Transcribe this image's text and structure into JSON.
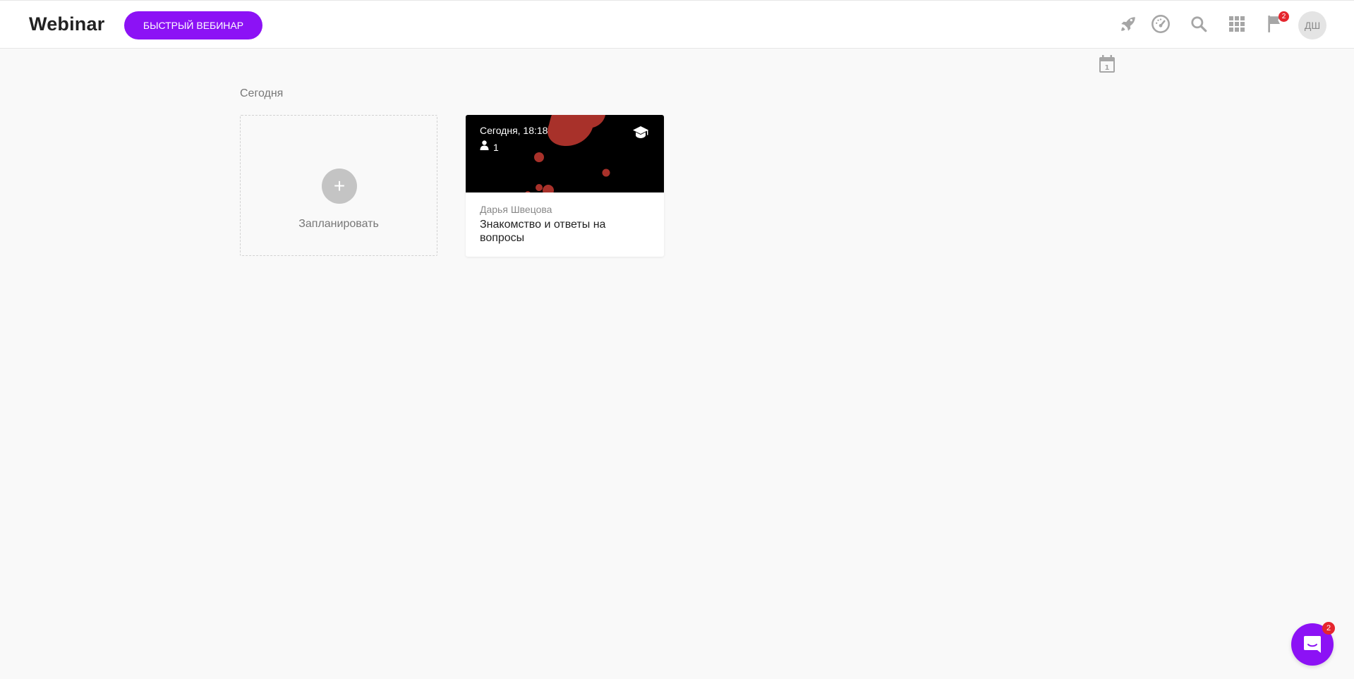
{
  "header": {
    "logo": "Webinar",
    "quick_webinar_label": "БЫСТРЫЙ ВЕБИНАР",
    "notifications_count": "2",
    "avatar_initials": "ДШ"
  },
  "main": {
    "section_title": "Сегодня",
    "schedule_label": "Запланировать",
    "events": [
      {
        "time": "Сегодня, 18:18",
        "participants": "1",
        "author": "Дарья Швецова",
        "title": "Знакомство и ответы на вопросы"
      }
    ]
  },
  "chat": {
    "unread_count": "2"
  },
  "colors": {
    "accent": "#8c12f5",
    "badge": "#e5262e",
    "icon_gray": "#a6a6a6"
  }
}
